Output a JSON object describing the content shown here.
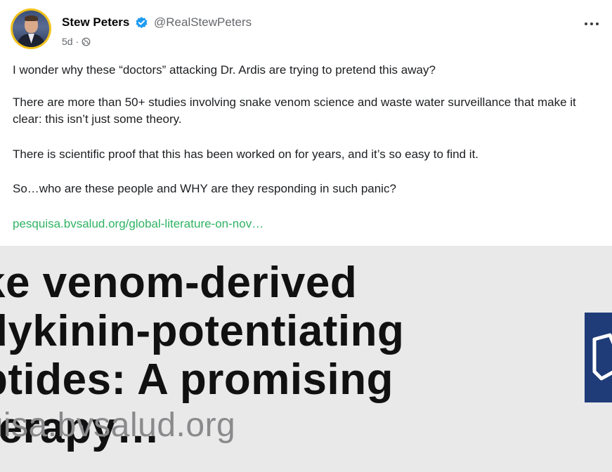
{
  "author": {
    "name": "Stew Peters",
    "handle": "@RealStewPeters",
    "verified_icon": "verified-badge-icon",
    "avatar_border_color": "#f1c21b"
  },
  "meta": {
    "time": "5d",
    "separator": "·",
    "audience_icon": "globe-icon"
  },
  "post": {
    "paragraphs": [
      "I wonder why these “doctors” attacking Dr. Ardis are trying to pretend this away?",
      "There are more than 50+ studies involving snake venom science and waste water surveillance that make it clear: this isn’t just some theory.",
      "There is scientific proof that this has been worked on for years, and it’s so easy to find it.",
      "So…who are these people and WHY are they responding in such panic?"
    ],
    "link_text": "pesquisa.bvsalud.org/global-literature-on-nov…",
    "link_color": "#2fb363"
  },
  "preview": {
    "title": "ake venom-derived\nadykinin-potentiating\neptides: A promising therapy…",
    "domain": "squisa.bvsalud.org",
    "thumb_color": "#1f3c78"
  },
  "actions": {
    "more_icon": "more-options-icon"
  }
}
